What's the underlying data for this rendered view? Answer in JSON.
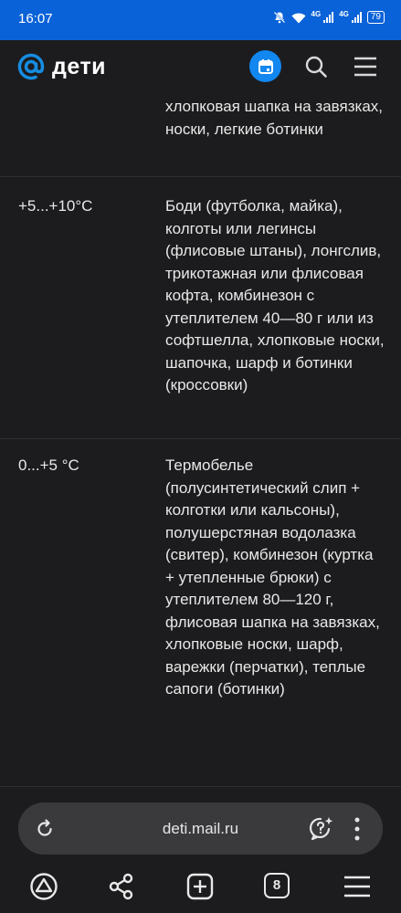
{
  "statusbar": {
    "time": "16:07",
    "net1": "4G",
    "net2": "4G",
    "battery": "79"
  },
  "header": {
    "logo_text": "дети"
  },
  "rows": [
    {
      "temp": "",
      "clothes": "хлопковая шапка на завязках, носки, легкие ботинки"
    },
    {
      "temp": "+5...+10°C",
      "clothes": "Боди (футболка, майка), колготы или легинсы (флисовые штаны), лонгслив, трикотажная или флисовая кофта, комбинезон с утеплителем 40—80 г или из софтшелла, хлопковые носки, шапочка, шарф и ботинки (кроссовки)"
    },
    {
      "temp": "0...+5 °C",
      "clothes": "Термобелье (полусинтетический слип + колготки или кальсоны), полушерстяная водолазка (свитер), комбинезон (куртка + утепленные брюки) с утеплителем 80—120 г, флисовая шапка на завязках, хлопковые носки, шарф, варежки (перчатки), теплые сапоги (ботинки)"
    }
  ],
  "addressbar": {
    "url": "deti.mail.ru"
  },
  "bottomnav": {
    "tabs_count": "8"
  },
  "colors": {
    "statusbar": "#0a62d8",
    "accent": "#1187ef",
    "background": "#1c1c1e"
  }
}
